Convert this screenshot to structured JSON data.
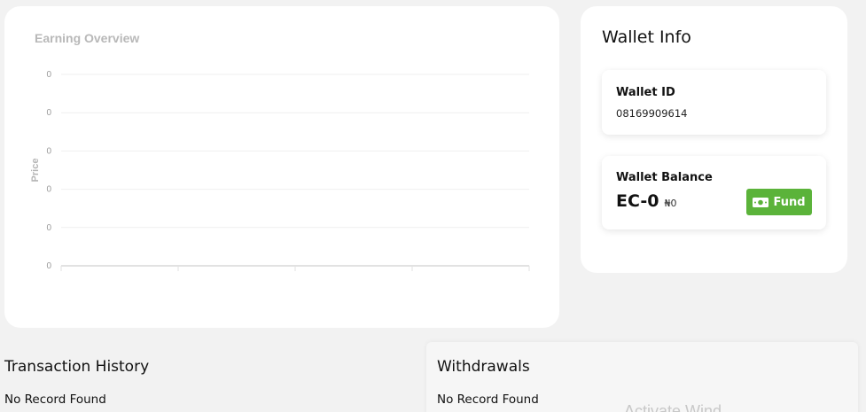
{
  "earning": {
    "title": "Earning Overview"
  },
  "chart_data": {
    "type": "line",
    "title": "Earning Overview",
    "ylabel": "Price",
    "xlabel": "",
    "y_tick_labels": [
      "0",
      "0",
      "0",
      "0",
      "0",
      "0"
    ],
    "categories": [],
    "series": [],
    "x_tick_count": 5,
    "grid": true,
    "legend": "none"
  },
  "wallet": {
    "title": "Wallet Info",
    "id_label": "Wallet ID",
    "id_value": "08169909614",
    "balance_label": "Wallet Balance",
    "balance_main": "EC-0",
    "balance_sub": "₦0",
    "fund_label": "Fund",
    "fund_color": "#5bb33a"
  },
  "transactions": {
    "title": "Transaction History",
    "empty_text": "No Record Found"
  },
  "withdrawals": {
    "title": "Withdrawals",
    "empty_text": "No Record Found"
  },
  "watermark": "Activate Wind"
}
